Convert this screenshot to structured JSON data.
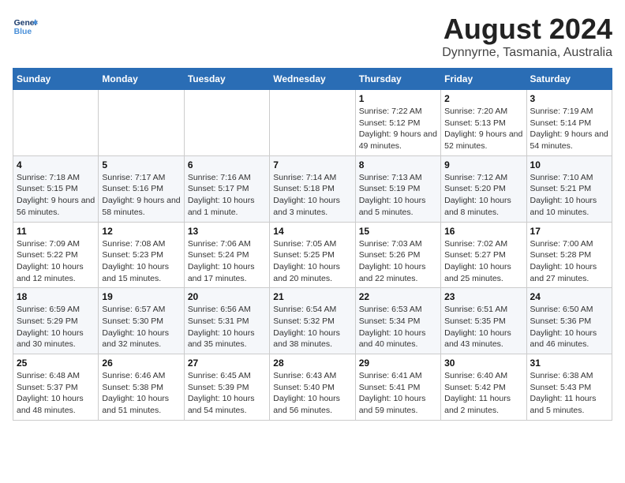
{
  "header": {
    "logo_line1": "General",
    "logo_line2": "Blue",
    "month_year": "August 2024",
    "location": "Dynnyrne, Tasmania, Australia"
  },
  "weekdays": [
    "Sunday",
    "Monday",
    "Tuesday",
    "Wednesday",
    "Thursday",
    "Friday",
    "Saturday"
  ],
  "weeks": [
    [
      null,
      null,
      null,
      null,
      {
        "day": "1",
        "sunrise": "7:22 AM",
        "sunset": "5:12 PM",
        "daylight": "9 hours and 49 minutes."
      },
      {
        "day": "2",
        "sunrise": "7:20 AM",
        "sunset": "5:13 PM",
        "daylight": "9 hours and 52 minutes."
      },
      {
        "day": "3",
        "sunrise": "7:19 AM",
        "sunset": "5:14 PM",
        "daylight": "9 hours and 54 minutes."
      }
    ],
    [
      {
        "day": "4",
        "sunrise": "7:18 AM",
        "sunset": "5:15 PM",
        "daylight": "9 hours and 56 minutes."
      },
      {
        "day": "5",
        "sunrise": "7:17 AM",
        "sunset": "5:16 PM",
        "daylight": "9 hours and 58 minutes."
      },
      {
        "day": "6",
        "sunrise": "7:16 AM",
        "sunset": "5:17 PM",
        "daylight": "10 hours and 1 minute."
      },
      {
        "day": "7",
        "sunrise": "7:14 AM",
        "sunset": "5:18 PM",
        "daylight": "10 hours and 3 minutes."
      },
      {
        "day": "8",
        "sunrise": "7:13 AM",
        "sunset": "5:19 PM",
        "daylight": "10 hours and 5 minutes."
      },
      {
        "day": "9",
        "sunrise": "7:12 AM",
        "sunset": "5:20 PM",
        "daylight": "10 hours and 8 minutes."
      },
      {
        "day": "10",
        "sunrise": "7:10 AM",
        "sunset": "5:21 PM",
        "daylight": "10 hours and 10 minutes."
      }
    ],
    [
      {
        "day": "11",
        "sunrise": "7:09 AM",
        "sunset": "5:22 PM",
        "daylight": "10 hours and 12 minutes."
      },
      {
        "day": "12",
        "sunrise": "7:08 AM",
        "sunset": "5:23 PM",
        "daylight": "10 hours and 15 minutes."
      },
      {
        "day": "13",
        "sunrise": "7:06 AM",
        "sunset": "5:24 PM",
        "daylight": "10 hours and 17 minutes."
      },
      {
        "day": "14",
        "sunrise": "7:05 AM",
        "sunset": "5:25 PM",
        "daylight": "10 hours and 20 minutes."
      },
      {
        "day": "15",
        "sunrise": "7:03 AM",
        "sunset": "5:26 PM",
        "daylight": "10 hours and 22 minutes."
      },
      {
        "day": "16",
        "sunrise": "7:02 AM",
        "sunset": "5:27 PM",
        "daylight": "10 hours and 25 minutes."
      },
      {
        "day": "17",
        "sunrise": "7:00 AM",
        "sunset": "5:28 PM",
        "daylight": "10 hours and 27 minutes."
      }
    ],
    [
      {
        "day": "18",
        "sunrise": "6:59 AM",
        "sunset": "5:29 PM",
        "daylight": "10 hours and 30 minutes."
      },
      {
        "day": "19",
        "sunrise": "6:57 AM",
        "sunset": "5:30 PM",
        "daylight": "10 hours and 32 minutes."
      },
      {
        "day": "20",
        "sunrise": "6:56 AM",
        "sunset": "5:31 PM",
        "daylight": "10 hours and 35 minutes."
      },
      {
        "day": "21",
        "sunrise": "6:54 AM",
        "sunset": "5:32 PM",
        "daylight": "10 hours and 38 minutes."
      },
      {
        "day": "22",
        "sunrise": "6:53 AM",
        "sunset": "5:34 PM",
        "daylight": "10 hours and 40 minutes."
      },
      {
        "day": "23",
        "sunrise": "6:51 AM",
        "sunset": "5:35 PM",
        "daylight": "10 hours and 43 minutes."
      },
      {
        "day": "24",
        "sunrise": "6:50 AM",
        "sunset": "5:36 PM",
        "daylight": "10 hours and 46 minutes."
      }
    ],
    [
      {
        "day": "25",
        "sunrise": "6:48 AM",
        "sunset": "5:37 PM",
        "daylight": "10 hours and 48 minutes."
      },
      {
        "day": "26",
        "sunrise": "6:46 AM",
        "sunset": "5:38 PM",
        "daylight": "10 hours and 51 minutes."
      },
      {
        "day": "27",
        "sunrise": "6:45 AM",
        "sunset": "5:39 PM",
        "daylight": "10 hours and 54 minutes."
      },
      {
        "day": "28",
        "sunrise": "6:43 AM",
        "sunset": "5:40 PM",
        "daylight": "10 hours and 56 minutes."
      },
      {
        "day": "29",
        "sunrise": "6:41 AM",
        "sunset": "5:41 PM",
        "daylight": "10 hours and 59 minutes."
      },
      {
        "day": "30",
        "sunrise": "6:40 AM",
        "sunset": "5:42 PM",
        "daylight": "11 hours and 2 minutes."
      },
      {
        "day": "31",
        "sunrise": "6:38 AM",
        "sunset": "5:43 PM",
        "daylight": "11 hours and 5 minutes."
      }
    ]
  ],
  "labels": {
    "sunrise": "Sunrise:",
    "sunset": "Sunset:",
    "daylight": "Daylight:"
  }
}
